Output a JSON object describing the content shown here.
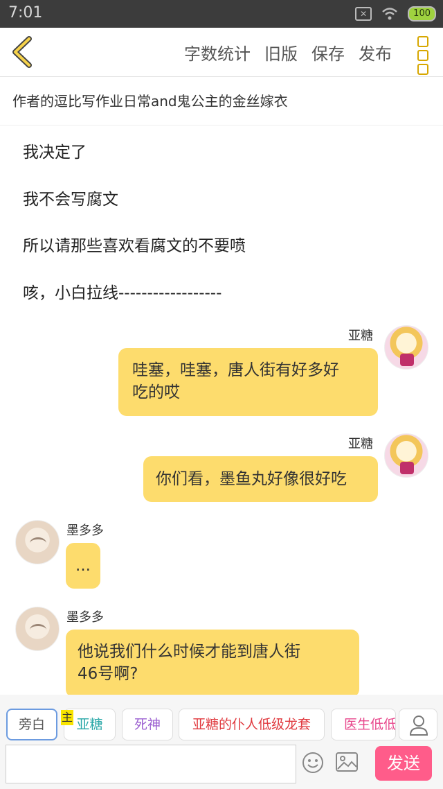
{
  "status_bar": {
    "time": "7:01",
    "battery": "100",
    "sim_icon": "x-sim-icon"
  },
  "toolbar": {
    "word_count": "字数统计",
    "old_version": "旧版",
    "save": "保存",
    "publish": "发布"
  },
  "title": "作者的逗比写作业日常and鬼公主的金丝嫁衣",
  "narration": [
    "我决定了",
    "我不会写腐文",
    "所以请那些喜欢看腐文的不要喷",
    "咳，小白拉线------------------"
  ],
  "messages": [
    {
      "speaker": "亚糖",
      "side": "right",
      "text_lines": [
        "哇塞，哇塞，唐人街有好多好",
        "吃的哎"
      ]
    },
    {
      "speaker": "亚糖",
      "side": "right",
      "text_lines": [
        "你们看，墨鱼丸好像很好吃"
      ]
    },
    {
      "speaker": "墨多多",
      "side": "left",
      "text_lines": [
        "..."
      ]
    },
    {
      "speaker": "墨多多",
      "side": "left",
      "text_lines": [
        "他说我们什么时候才能到唐人街",
        "46号啊?"
      ]
    }
  ],
  "roles": {
    "narrator": "旁白",
    "main_badge": "主",
    "items": [
      "亚糖",
      "死神",
      "亚糖的仆人低级龙套",
      "医生低低"
    ]
  },
  "colors": {
    "bubble": "#fddc6d",
    "send_button": "#ff5c8a",
    "role_sugar": "#2aa8a8",
    "role_death": "#9b5fd0",
    "role_servant": "#e0393e",
    "role_doctor": "#e8478c"
  },
  "input": {
    "value": "",
    "send_label": "发送"
  }
}
